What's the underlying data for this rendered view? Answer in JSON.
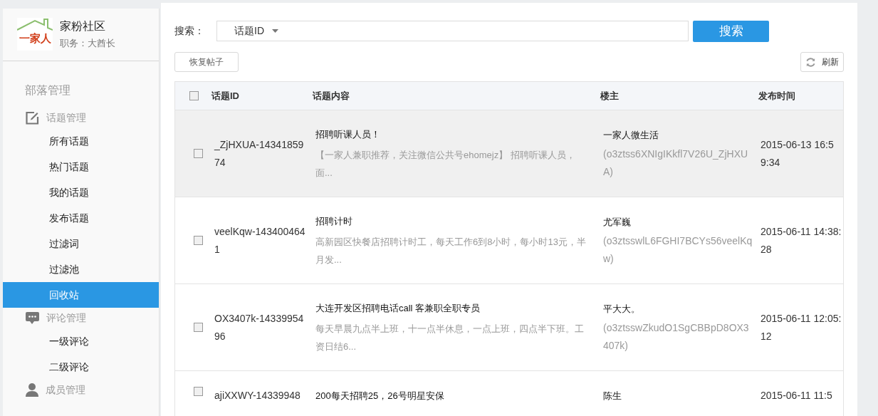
{
  "sidebar": {
    "logo_text": "一家人",
    "community_name": "家粉社区",
    "role": "职务：大酋长",
    "section_title": "部落管理",
    "groups": [
      {
        "kind": "edit",
        "label": "话题管理",
        "items": [
          {
            "label": "所有话题",
            "selected": false
          },
          {
            "label": "热门话题",
            "selected": false
          },
          {
            "label": "我的话题",
            "selected": false
          },
          {
            "label": "发布话题",
            "selected": false
          },
          {
            "label": "过滤词",
            "selected": false
          },
          {
            "label": "过滤池",
            "selected": false
          },
          {
            "label": "回收站",
            "selected": true
          }
        ]
      },
      {
        "kind": "comment",
        "label": "评论管理",
        "items": [
          {
            "label": "一级评论",
            "selected": false
          },
          {
            "label": "二级评论",
            "selected": false
          }
        ]
      },
      {
        "kind": "user",
        "label": "成员管理"
      }
    ]
  },
  "search": {
    "label": "搜索：",
    "type_select": "话题ID",
    "button": "搜索"
  },
  "toolbar": {
    "restore_button": "恢复帖子",
    "refresh_button": "刷新"
  },
  "table": {
    "columns": [
      "话题ID",
      "话题内容",
      "楼主",
      "发布时间"
    ],
    "select_all_checked": false,
    "rows": [
      {
        "id": "_ZjHXUA-1434185974",
        "title": "招聘听课人员！",
        "summary": "【一家人兼职推荐，关注微信公共号ehomejz】 招聘听课人员，面...",
        "owner": "一家人微生活",
        "owner_id": "(o3ztss6XNIgIKkfl7V26U_ZjHXUA)",
        "time": "2015-06-13 16:59:34",
        "checked": false,
        "selected": true
      },
      {
        "id": "veelKqw-1434004641",
        "title": "招聘计时",
        "summary": "高新园区快餐店招聘计时工，每天工作6到8小时，每小时13元，半月发...",
        "owner": "尤军巍",
        "owner_id": "(o3ztsswlL6FGHI7BCYs56veelKqw)",
        "time": "2015-06-11 14:38:28",
        "checked": false,
        "selected": false
      },
      {
        "id": "OX3407k-1433995496",
        "title": "大连开发区招聘电话call 客兼职全职专员",
        "summary": "每天早晨九点半上班，十一点半休息，一点上班，四点半下班。工资日结6...",
        "owner": "平大大。",
        "owner_id": "(o3ztsswZkudO1SgCBBpD8OX3407k)",
        "time": "2015-06-11 12:05:12",
        "checked": false,
        "selected": false
      },
      {
        "id": "ajiXXWY-14339948",
        "title": "200每天招聘25，26号明星安保",
        "owner": "陈生",
        "time": "2015-06-11 11:5",
        "checked": false,
        "selected": false
      }
    ]
  }
}
